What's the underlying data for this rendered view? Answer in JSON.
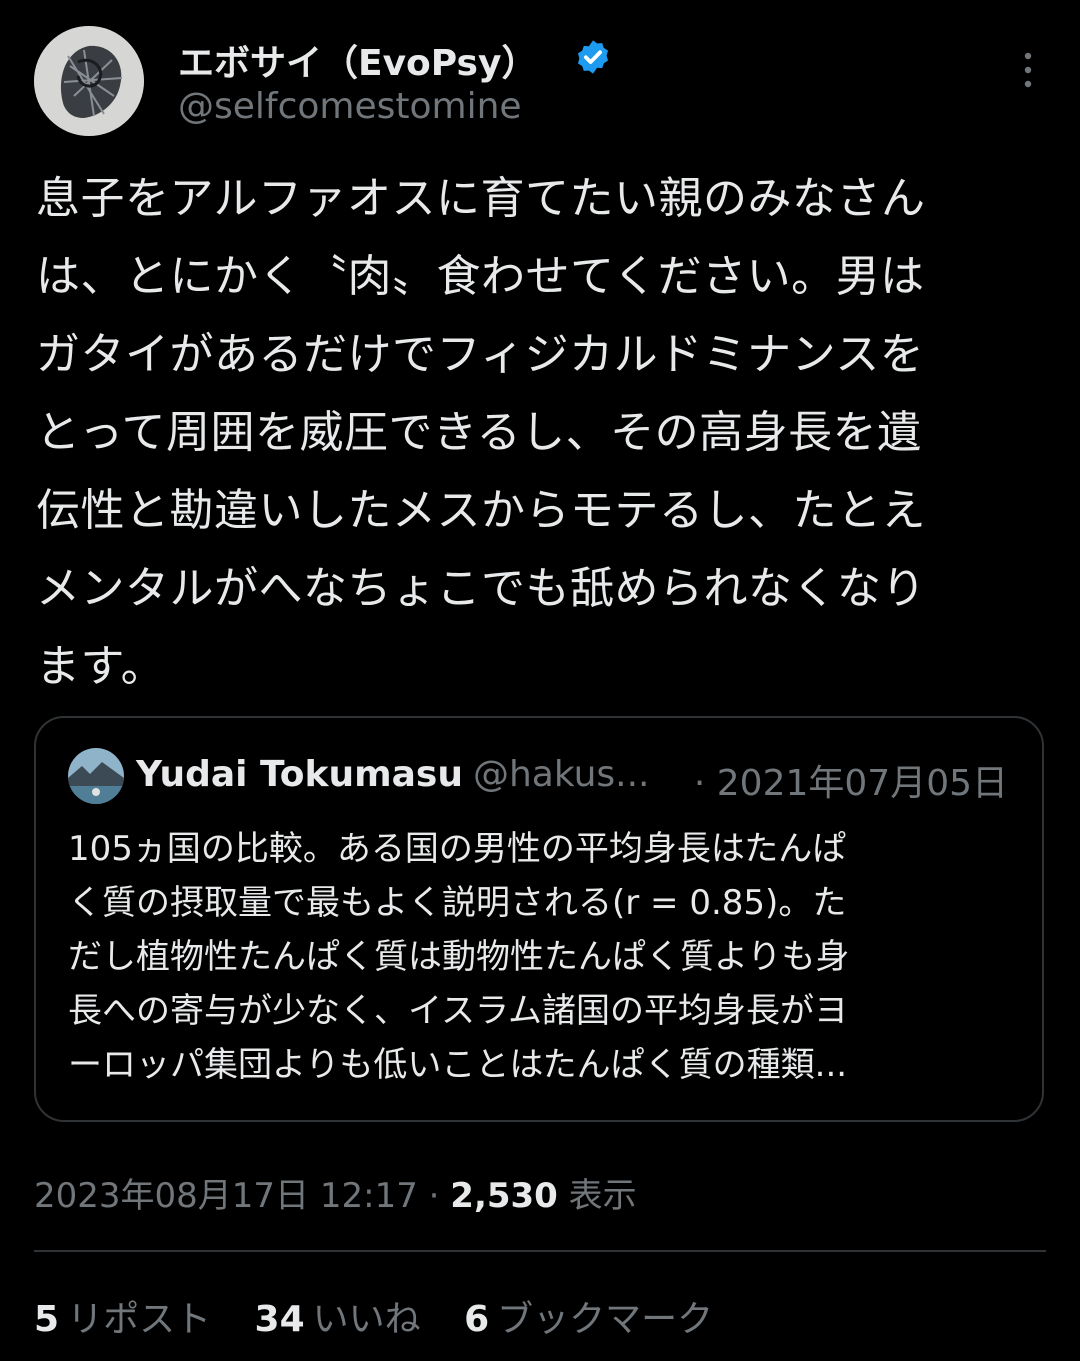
{
  "author": {
    "display_name": "エボサイ（EvoPsy）",
    "handle": "@selfcomestomine",
    "verified_icon": "verified-badge-icon",
    "verified_color": "#1d9bf0"
  },
  "tweet": {
    "text": "息子をアルファオスに育てたい親のみなさん\nは、とにかく〝肉〟食わせてください。男は\nガタイがあるだけでフィジカルドミナンスを\nとって周囲を威圧できるし、その高身長を遺\n伝性と勘違いしたメスからモテるし、たとえ\nメンタルがへなちょこでも舐められなくなり\nます。"
  },
  "quote": {
    "name": "Yudai Tokumasu",
    "handle": "@hakus...",
    "date": "· 2021年07月05日",
    "text": "105ヵ国の比較。ある国の男性の平均身長はたんぱ\nく質の摂取量で最もよく説明される(r = 0.85)。た\nだし植物性たんぱく質は動物性たんぱく質よりも身\n長への寄与が少なく、イスラム諸国の平均身長がヨ\nーロッパ集団よりも低いことはたんぱく質の種類..."
  },
  "meta": {
    "timestamp": "2023年08月17日 12:17 ·",
    "views_count": "2,530",
    "views_label": "表示"
  },
  "stats": {
    "reposts_count": "5",
    "reposts_label": "リポスト",
    "likes_count": "34",
    "likes_label": "いいね",
    "bookmarks_count": "6",
    "bookmarks_label": "ブックマーク"
  },
  "colors": {
    "background": "#000000",
    "primary_text": "#e7e9ea",
    "secondary_text": "#71767b",
    "border": "#2f3336"
  }
}
